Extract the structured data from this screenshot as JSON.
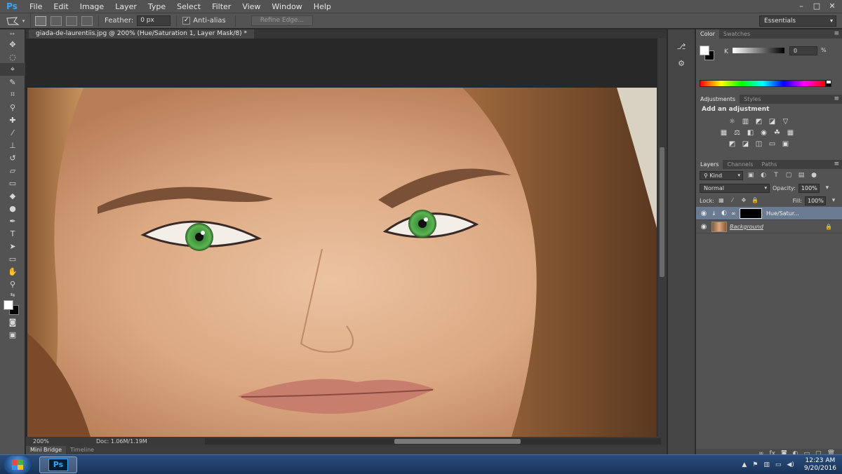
{
  "app": {
    "logo": "Ps"
  },
  "menu": [
    "File",
    "Edit",
    "Image",
    "Layer",
    "Type",
    "Select",
    "Filter",
    "View",
    "Window",
    "Help"
  ],
  "window_buttons": {
    "minimize": "–",
    "maximize": "□",
    "close": "✕"
  },
  "options": {
    "feather_label": "Feather:",
    "feather_value": "0 px",
    "antialias_label": "Anti-alias",
    "antialias_checked": true,
    "refine_edge": "Refine Edge...",
    "workspace": "Essentials"
  },
  "document": {
    "tab_title": "giada-de-laurentiis.jpg @ 200% (Hue/Saturation 1, Layer Mask/8) *",
    "zoom": "200%",
    "doc_size": "Doc: 1.06M/1.19M"
  },
  "bottom_tabs": [
    "Mini Bridge",
    "Timeline"
  ],
  "color_panel": {
    "tabs": [
      "Color",
      "Swatches"
    ],
    "channel": "K",
    "value": "0",
    "unit": "%"
  },
  "adjustments_panel": {
    "tabs": [
      "Adjustments",
      "Styles"
    ],
    "title": "Add an adjustment"
  },
  "layers_panel": {
    "tabs": [
      "Layers",
      "Channels",
      "Paths"
    ],
    "filter": "Kind",
    "blend_mode": "Normal",
    "opacity_label": "Opacity:",
    "opacity": "100%",
    "lock_label": "Lock:",
    "fill_label": "Fill:",
    "fill": "100%",
    "layers": [
      {
        "name": "Hue/Satur...",
        "type": "adjustment",
        "selected": true
      },
      {
        "name": "Background",
        "type": "image",
        "selected": false
      }
    ]
  },
  "taskbar": {
    "time": "12:23 AM",
    "date": "9/20/2016"
  },
  "colors": {
    "fg": "#ffffff",
    "bg": "#000000",
    "selected_layer": "#6a7b92",
    "eye_iris": "#4da84a"
  }
}
